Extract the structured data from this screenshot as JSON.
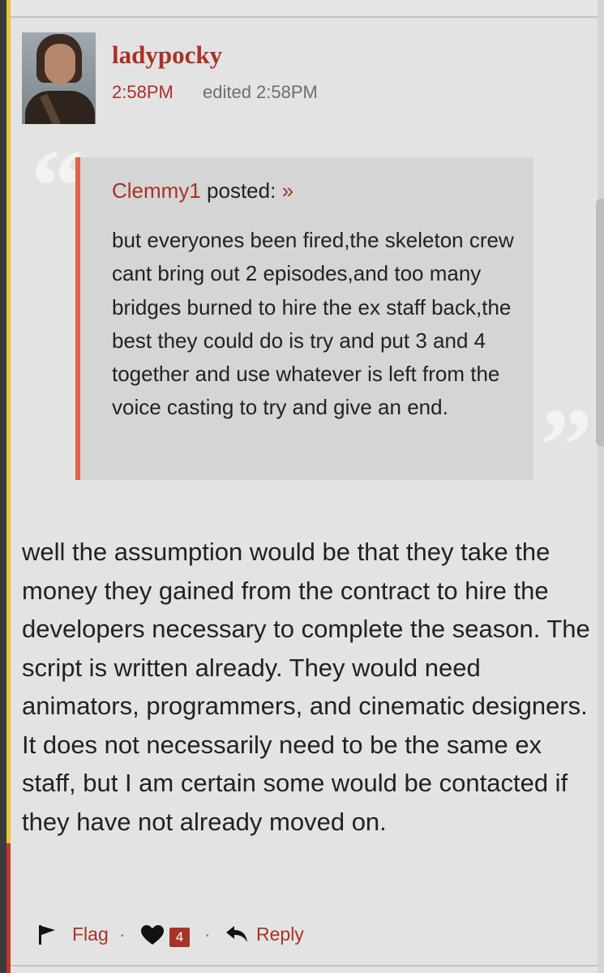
{
  "post": {
    "username": "ladypocky",
    "time": "2:58PM",
    "edited": "edited 2:58PM"
  },
  "quote": {
    "author": "Clemmy1",
    "posted_label": "posted:",
    "link_glyph": "»",
    "text": "but everyones been fired,the skeleton crew cant bring out 2 episodes,and too many bridges burned to hire the ex staff back,the best they could do is try and put 3 and 4 together and use whatever is left from the voice casting to try and give an end."
  },
  "body": {
    "text": "well the assumption would be that they take the money they gained from the contract to hire the developers necessary to complete the season. The script is written already. They would need animators, programmers, and cinematic designers. It does not necessarily need to be the same ex staff, but I am certain some would be contacted if they have not already moved on."
  },
  "actions": {
    "flag_label": "Flag",
    "separator": "·",
    "like_count": "4",
    "reply_label": "Reply"
  },
  "colors": {
    "accent": "#a93226",
    "quote_border": "#e0634a",
    "background": "#e3e3e3"
  },
  "icons": [
    "flag-icon",
    "heart-icon",
    "reply-icon",
    "avatar-image"
  ]
}
